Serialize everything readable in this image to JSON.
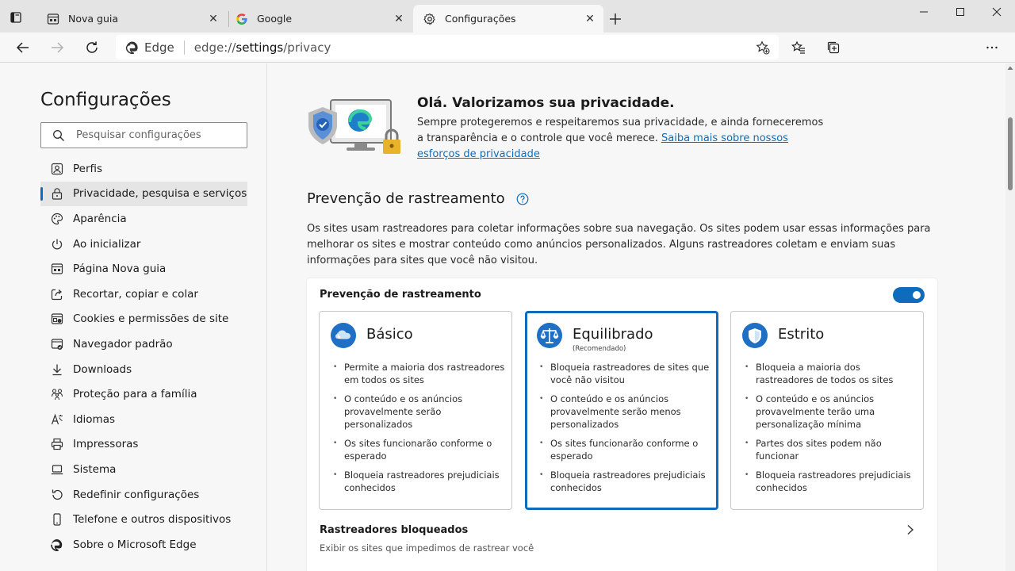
{
  "tabs": [
    {
      "label": "Nova guia",
      "icon": "new-tab-icon",
      "active": false
    },
    {
      "label": "Google",
      "icon": "google-icon",
      "active": false
    },
    {
      "label": "Configurações",
      "icon": "gear-icon",
      "active": true
    }
  ],
  "address_bar": {
    "site_label": "Edge",
    "url_prefix": "edge://",
    "url_host": "settings",
    "url_path": "/privacy"
  },
  "sidebar": {
    "title": "Configurações",
    "search_placeholder": "Pesquisar configurações",
    "items": [
      {
        "label": "Perfis",
        "icon": "profile-icon"
      },
      {
        "label": "Privacidade, pesquisa e serviços",
        "icon": "lock-icon",
        "selected": true
      },
      {
        "label": "Aparência",
        "icon": "palette-icon"
      },
      {
        "label": "Ao inicializar",
        "icon": "power-icon"
      },
      {
        "label": "Página Nova guia",
        "icon": "new-tab-page-icon"
      },
      {
        "label": "Recortar, copiar e colar",
        "icon": "share-icon"
      },
      {
        "label": "Cookies e permissões de site",
        "icon": "site-permissions-icon"
      },
      {
        "label": "Navegador padrão",
        "icon": "default-browser-icon"
      },
      {
        "label": "Downloads",
        "icon": "download-icon"
      },
      {
        "label": "Proteção para a família",
        "icon": "family-icon"
      },
      {
        "label": "Idiomas",
        "icon": "languages-icon"
      },
      {
        "label": "Impressoras",
        "icon": "printer-icon"
      },
      {
        "label": "Sistema",
        "icon": "laptop-icon"
      },
      {
        "label": "Redefinir configurações",
        "icon": "reset-icon"
      },
      {
        "label": "Telefone e outros dispositivos",
        "icon": "phone-icon"
      },
      {
        "label": "Sobre o Microsoft Edge",
        "icon": "edge-logo-icon"
      }
    ]
  },
  "hero": {
    "title": "Olá. Valorizamos sua privacidade.",
    "description": "Sempre protegeremos e respeitaremos sua privacidade, e ainda forneceremos a transparência e o controle que você merece. ",
    "link": "Saiba mais sobre nossos esforços de privacidade"
  },
  "tracking": {
    "section_title": "Prevenção de rastreamento",
    "section_description": "Os sites usam rastreadores para coletar informações sobre sua navegação. Os sites podem usar essas informações para melhorar os sites e mostrar conteúdo como anúncios personalizados. Alguns rastreadores coletam e enviam suas informações para sites que você não visitou.",
    "card_header": "Prevenção de rastreamento",
    "toggle_on": true,
    "levels": [
      {
        "name": "Básico",
        "subtitle": "",
        "icon": "basic-icon",
        "selected": false,
        "bullets": [
          "Permite a maioria dos rastreadores em todos os sites",
          "O conteúdo e os anúncios provavelmente serão personalizados",
          "Os sites funcionarão conforme o esperado",
          "Bloqueia rastreadores prejudiciais conhecidos"
        ]
      },
      {
        "name": "Equilibrado",
        "subtitle": "(Recomendado)",
        "icon": "balance-scale-icon",
        "selected": true,
        "bullets": [
          "Bloqueia rastreadores de sites que você não visitou",
          "O conteúdo e os anúncios provavelmente serão menos personalizados",
          "Os sites funcionarão conforme o esperado",
          "Bloqueia rastreadores prejudiciais conhecidos"
        ]
      },
      {
        "name": "Estrito",
        "subtitle": "",
        "icon": "shield-icon",
        "selected": false,
        "bullets": [
          "Bloqueia a maioria dos rastreadores de todos os sites",
          "O conteúdo e os anúncios provavelmente terão uma personalização mínima",
          "Partes dos sites podem não funcionar",
          "Bloqueia rastreadores prejudiciais conhecidos"
        ]
      }
    ],
    "blocked_title": "Rastreadores bloqueados",
    "blocked_subtitle": "Exibir os sites que impedimos de rastrear você"
  },
  "colors": {
    "accent": "#0f6cbd",
    "toggle_on": "#0f6cbd"
  }
}
